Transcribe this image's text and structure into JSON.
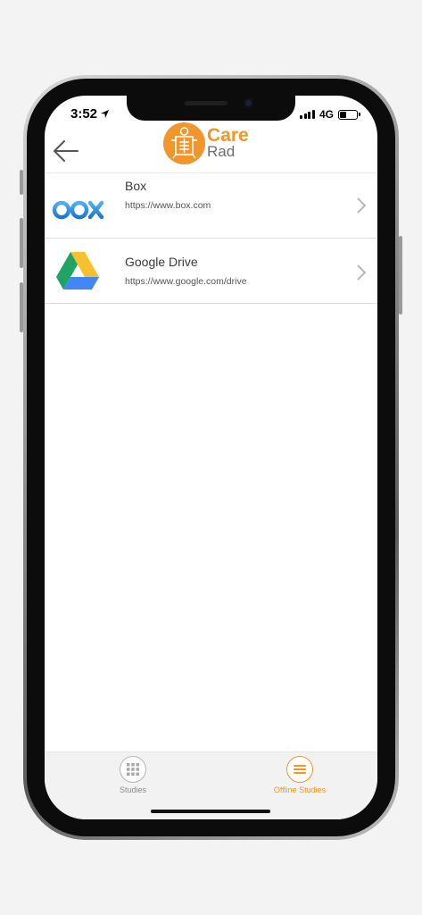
{
  "status": {
    "time": "3:52",
    "network": "4G",
    "battery_level": 0.4
  },
  "header": {
    "logo_care": "Care",
    "logo_rad": "Rad"
  },
  "providers": [
    {
      "name": "Box",
      "url": "https://www.box.com",
      "icon": "box-logo-icon"
    },
    {
      "name": "Google Drive",
      "url": "https://www.google.com/drive",
      "icon": "google-drive-icon"
    }
  ],
  "tabs": [
    {
      "label": "Studies",
      "icon": "grid-icon",
      "active": false
    },
    {
      "label": "Offline Studies",
      "icon": "menu-icon",
      "active": true
    }
  ],
  "colors": {
    "accent": "#f0962a",
    "inactive": "#8a8a8a",
    "box_blue": "#2a8ad8"
  }
}
